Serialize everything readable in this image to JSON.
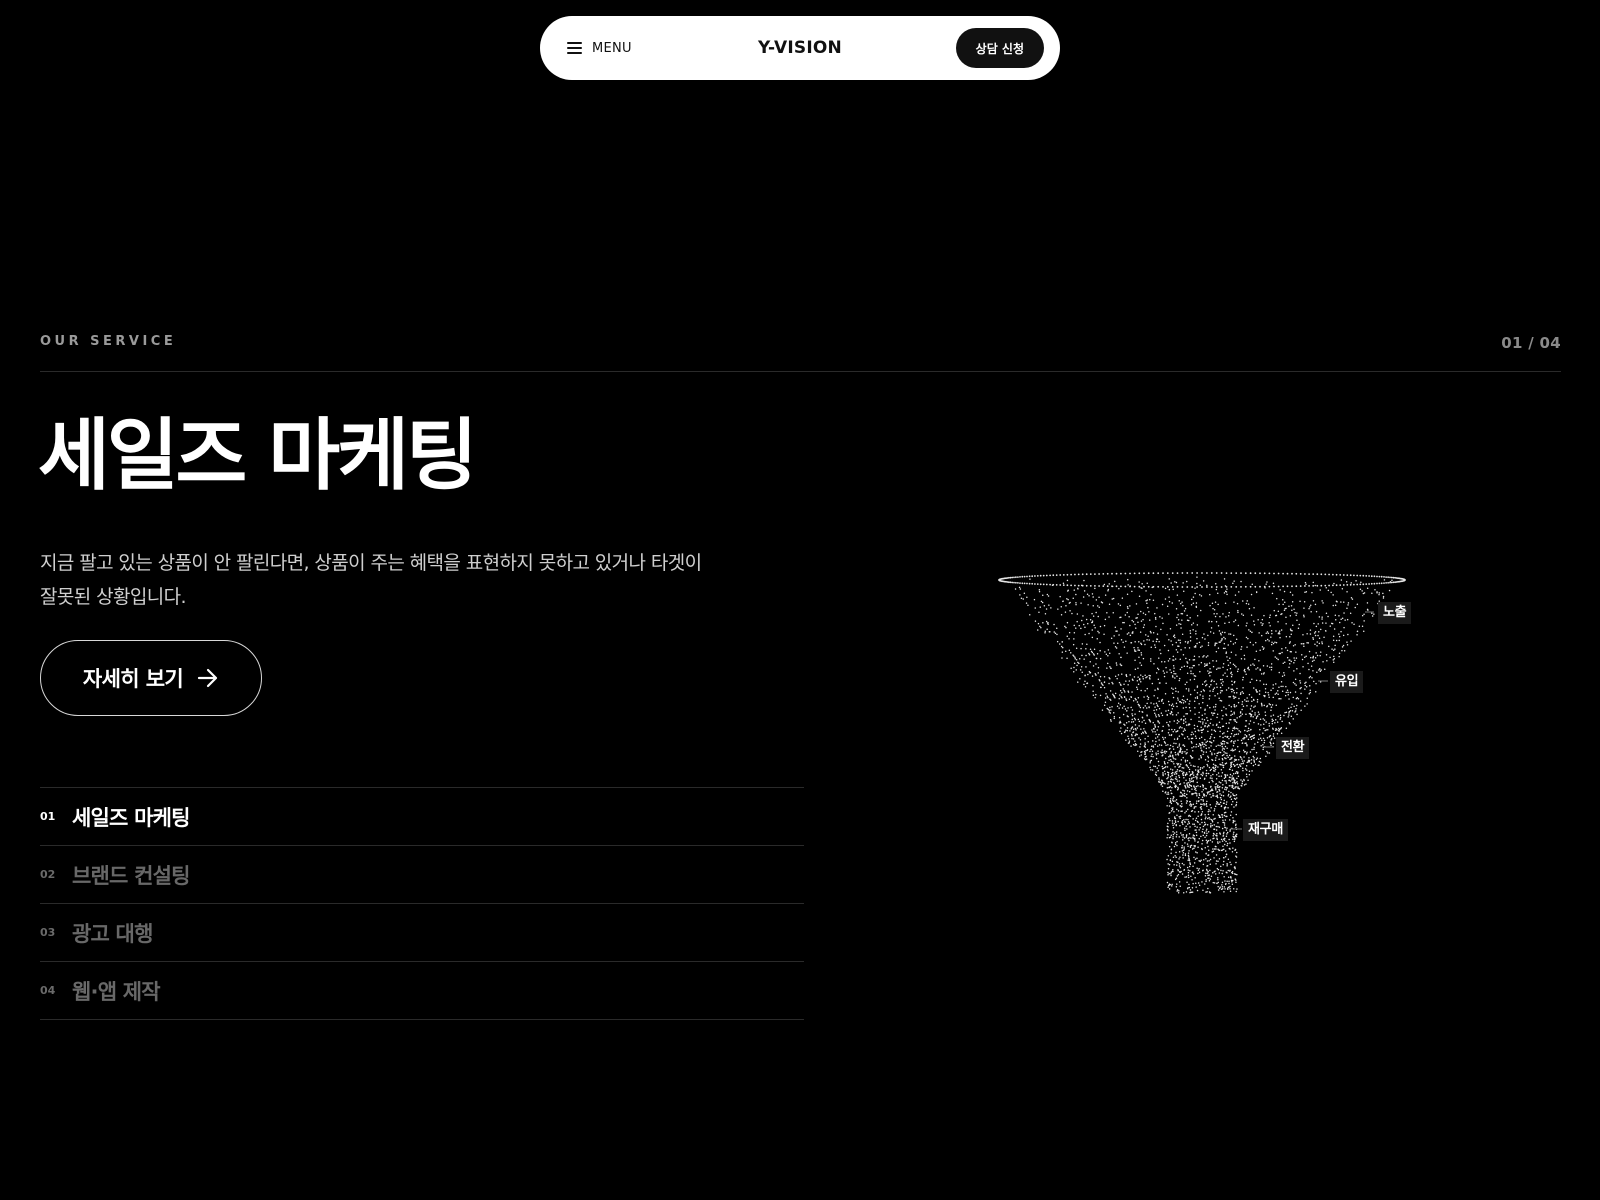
{
  "header": {
    "menu_label": "MENU",
    "brand": "Y-VISION",
    "cta_label": "상담 신청"
  },
  "section": {
    "eyebrow": "OUR SERVICE",
    "counter": "01 / 04"
  },
  "hero": {
    "title": "세일즈 마케팅",
    "desc_line1": "지금 팔고 있는 상품이 안 팔린다면, 상품이 주는 혜택을 표현하지 못하고 있거나 타겟이",
    "desc_line2": "잘못된 상황입니다.",
    "detail_label": "자세히 보기"
  },
  "services": [
    {
      "num": "01",
      "name": "세일즈 마케팅",
      "active": true
    },
    {
      "num": "02",
      "name": "브랜드 컨설팅",
      "active": false
    },
    {
      "num": "03",
      "name": "광고 대행",
      "active": false
    },
    {
      "num": "04",
      "name": "웹·앱 제작",
      "active": false
    }
  ],
  "funnel": {
    "stages": [
      "노출",
      "유입",
      "전환",
      "재구매"
    ]
  },
  "icons": {
    "menu": "hamburger-icon",
    "detail": "arrow-right-icon"
  },
  "colors": {
    "background": "#000000",
    "nav_background": "#ffffff",
    "cta_background": "#111111",
    "muted_text": "#686868"
  }
}
